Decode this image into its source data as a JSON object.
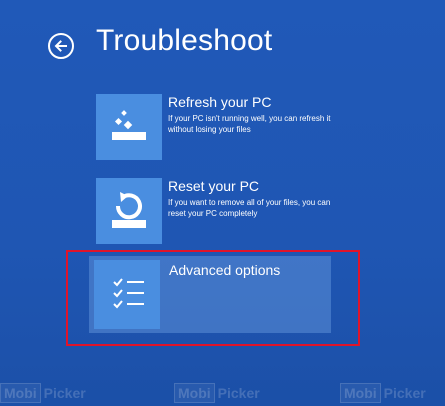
{
  "header": {
    "title": "Troubleshoot"
  },
  "options": [
    {
      "title": "Refresh your PC",
      "description": "If your PC isn't running well, you can refresh it without losing your files"
    },
    {
      "title": "Reset your PC",
      "description": "If you want to remove all of your files, you can reset your PC completely"
    },
    {
      "title": "Advanced options"
    }
  ],
  "watermark": {
    "part1": "Mobi",
    "part2": "Picker"
  },
  "colors": {
    "background": "#1f56b3",
    "tile": "#4a8ee0",
    "highlight": "#e0142a"
  }
}
